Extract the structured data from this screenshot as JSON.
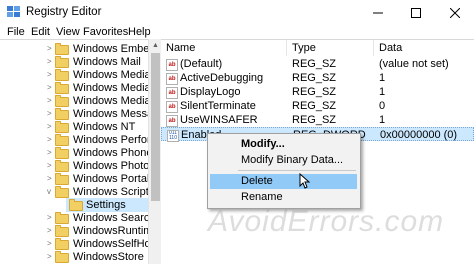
{
  "window": {
    "title": "Registry Editor",
    "minimize_icon": "minimize-icon",
    "maximize_icon": "maximize-icon",
    "close_icon": "close-icon"
  },
  "menu": [
    "File",
    "Edit",
    "View",
    "Favorites",
    "Help"
  ],
  "tree": [
    {
      "label": "Windows Embedde",
      "chevron": ">"
    },
    {
      "label": "Windows Mail",
      "chevron": ">"
    },
    {
      "label": "Windows Media De",
      "chevron": ">"
    },
    {
      "label": "Windows Media Fo",
      "chevron": ">"
    },
    {
      "label": "Windows Media Pl",
      "chevron": ">"
    },
    {
      "label": "Windows Messagin",
      "chevron": ">"
    },
    {
      "label": "Windows NT",
      "chevron": ">"
    },
    {
      "label": "Windows Performa",
      "chevron": ">"
    },
    {
      "label": "Windows Phone",
      "chevron": ">"
    },
    {
      "label": "Windows Photo Vie",
      "chevron": ">"
    },
    {
      "label": "Windows Portable",
      "chevron": ">"
    },
    {
      "label": "Windows Script Ho",
      "chevron": "v"
    },
    {
      "label": "Settings",
      "chevron": "",
      "selected": true
    },
    {
      "label": "Windows Search",
      "chevron": ">"
    },
    {
      "label": "WindowsRuntime",
      "chevron": ">"
    },
    {
      "label": "WindowsSelfHost",
      "chevron": ">"
    },
    {
      "label": "WindowsStore",
      "chevron": ">"
    }
  ],
  "columns": {
    "name": "Name",
    "type": "Type",
    "data": "Data"
  },
  "values": [
    {
      "icon": "ab",
      "name": "(Default)",
      "type": "REG_SZ",
      "data": "(value not set)"
    },
    {
      "icon": "ab",
      "name": "ActiveDebugging",
      "type": "REG_SZ",
      "data": "1"
    },
    {
      "icon": "ab",
      "name": "DisplayLogo",
      "type": "REG_SZ",
      "data": "1"
    },
    {
      "icon": "ab",
      "name": "SilentTerminate",
      "type": "REG_SZ",
      "data": "0"
    },
    {
      "icon": "ab",
      "name": "UseWINSAFER",
      "type": "REG_SZ",
      "data": "1"
    },
    {
      "icon": "bin",
      "name": "Enabled",
      "type": "REG_DWORD",
      "data": "0x00000000 (0)",
      "selected": true
    }
  ],
  "context_menu": {
    "modify": "Modify...",
    "modify_binary": "Modify Binary Data...",
    "delete": "Delete",
    "rename": "Rename"
  },
  "icons": {
    "ab": "ab",
    "bin": "011\n110"
  },
  "watermark": "AvoidErrors.com"
}
